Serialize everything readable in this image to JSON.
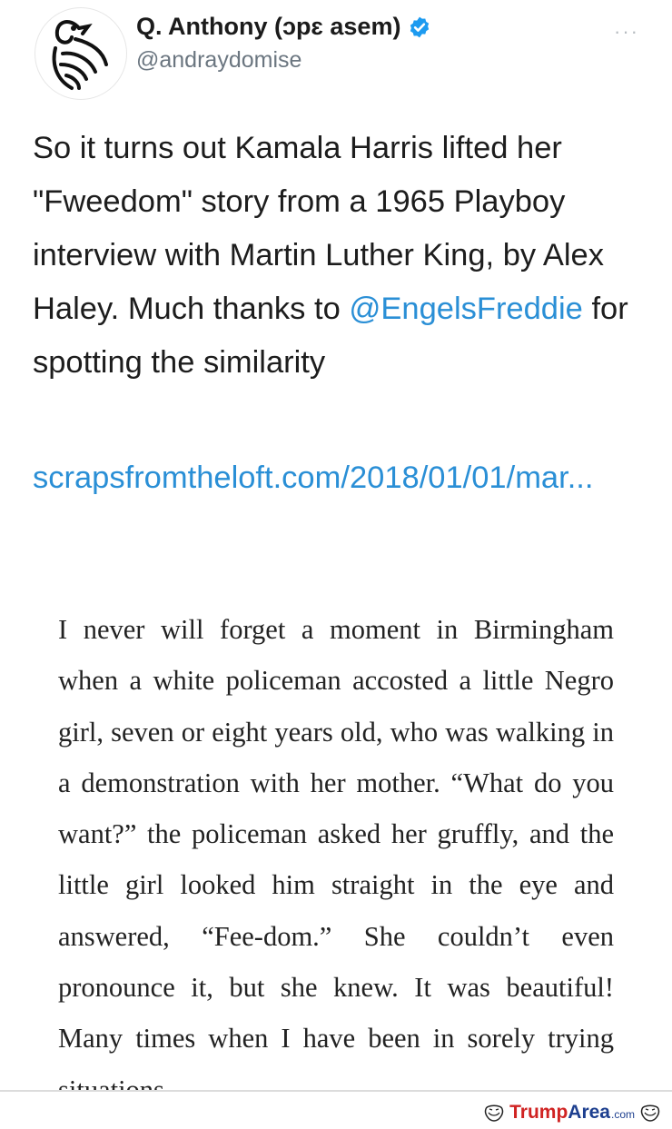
{
  "tweet": {
    "display_name": "Q. Anthony (ɔpɛ asem)",
    "handle": "@andraydomise",
    "more_label": "···",
    "text_before": "So it turns out Kamala Harris lifted her \"Fweedom\" story from a 1965 Playboy interview with Martin Luther King, by Alex Haley. Much thanks to ",
    "mention": "@EngelsFreddie",
    "text_after": " for spotting the similarity",
    "link": "scrapsfromtheloft.com/2018/01/01/mar..."
  },
  "quote": {
    "text": "I never will forget a moment in Birmingham when a white policeman accosted a little Negro girl, seven or eight years old, who was walking in a demonstration with her mother. “What do you want?” the policeman asked her gruffly, and the little girl looked him straight in the eye and answered, “Fee-dom.” She couldn’t even pronounce it, but she knew. It was beautiful! Many times when I have been in sorely trying situations"
  },
  "watermark": {
    "part1": "Trump",
    "part2": "Area",
    "suffix": ".com"
  },
  "colors": {
    "link": "#2a8fd6",
    "verified": "#1d9bf0",
    "watermark_red": "#d02322",
    "watermark_blue": "#1d3f8f"
  },
  "icons": [
    "sankofa-bird-avatar",
    "verified-badge-icon",
    "more-options-icon",
    "trollface-icon"
  ]
}
